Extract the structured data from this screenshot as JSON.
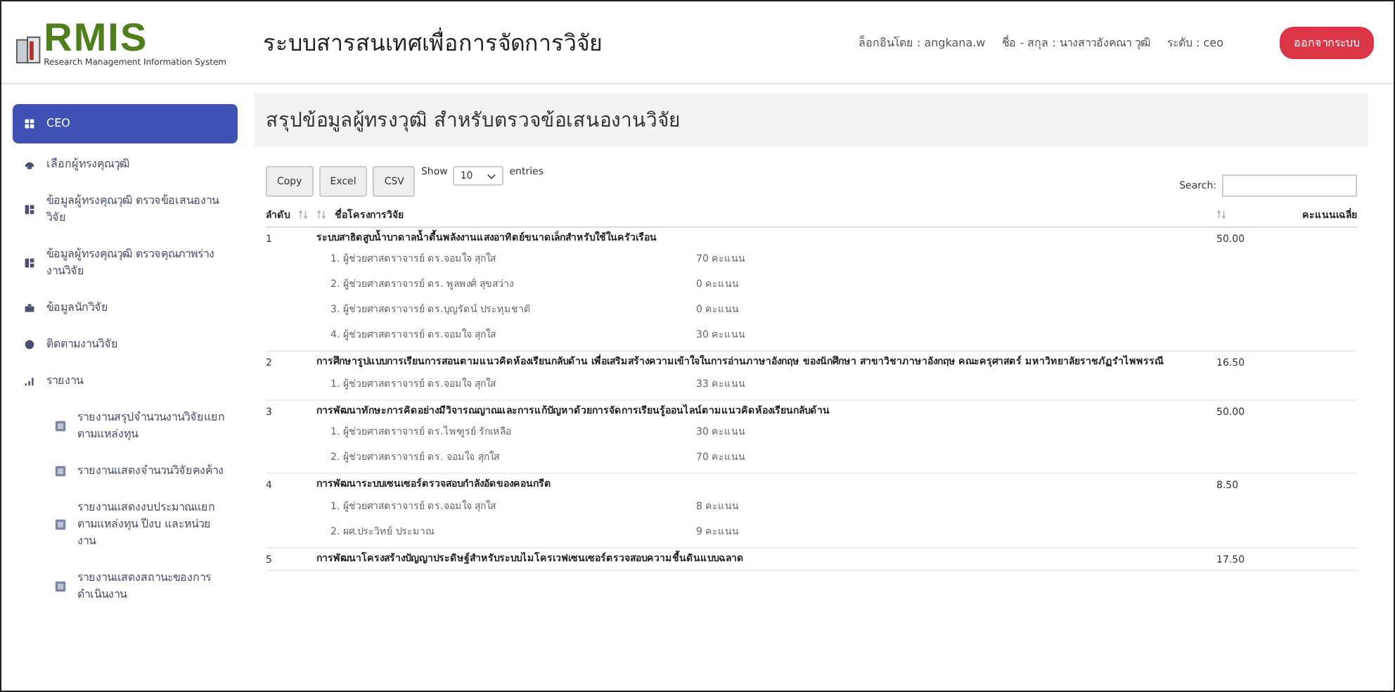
{
  "header": {
    "logo": {
      "letters": "RMIS",
      "tagline": "Research Management Information System"
    },
    "title": "ระบบสารสนเทศเพื่อการจัดการวิจัย",
    "login": "ล็อกอินโดย : angkana.w",
    "name": "ชื่อ - สกุล : นางสาวอังคณา วุฒิ",
    "level": "ระดับ : ceo",
    "logout": "ออกจากระบบ"
  },
  "sidebar": {
    "items": [
      {
        "label": "CEO",
        "selected": true
      },
      {
        "label": "เลือกผู้ทรงคุณวุฒิ",
        "selected": false
      },
      {
        "label": "ข้อมูลผู้ทรงคุณวุฒิ ตรวจข้อเสนองานวิจัย",
        "selected": false
      },
      {
        "label": "ข้อมูลผู้ทรงคุณวุฒิ ตรวจคุณภาพร่างงานวิจัย",
        "selected": false
      },
      {
        "label": "ข้อมูลนักวิจัย",
        "selected": false
      },
      {
        "label": "ติดตามงานวิจัย",
        "selected": false
      },
      {
        "label": "รายงาน",
        "selected": false,
        "children": [
          {
            "label": "รายงานสรุปจำนวนงานวิจัยแยกตามแหล่งทุน",
            "selected": false
          },
          {
            "label": "รายงานแสดงจำนวนวิจัยคงค้าง",
            "selected": false
          },
          {
            "label": "รายงานแสดงงบประมาณแยกตามแหล่งทุน ปีงบ และหน่วยงาน",
            "selected": false
          },
          {
            "label": "รายงานแสดงสถานะของการดำเนินงาน",
            "selected": false
          }
        ]
      }
    ]
  },
  "page_title": "สรุปข้อมูลผู้ทรงวุฒิ สำหรับตรวจข้อเสนองานวิจัย",
  "toolbar": {
    "buttons": [
      "Copy",
      "Excel",
      "CSV"
    ],
    "show_label": "Show",
    "page_size": "10",
    "entries_label": "entries",
    "search_label": "Search:"
  },
  "table": {
    "columns": [
      "ลำดับ",
      "ชื่อโครงการวิจัย",
      "คะแนนเฉลี่ย"
    ],
    "rows": [
      {
        "no": "1",
        "title": "ระบบสาธิตสูบน้ำบาดาลน้ำตื้นพลังงานแสงอาทิตย์ขนาดเล็กสำหรับใช้ในครัวเรือน",
        "average": "50.00",
        "reviewers": [
          {
            "name": "1. ผู้ช่วยศาสตราจารย์ ดร.จอมใจ สุกใส",
            "score": "70 คะแนน"
          },
          {
            "name": "2. ผู้ช่วยศาสตราจารย์ ดร. พูลพงศ์ สุขสว่าง",
            "score": "0 คะแนน"
          },
          {
            "name": "3. ผู้ช่วยศาสตราจารย์ ดร.บุญรัตน์ ประทุมชาติ",
            "score": "0 คะแนน"
          },
          {
            "name": "4. ผู้ช่วยศาสตราจารย์ ดร.จอมใจ สุกใส",
            "score": "30 คะแนน"
          }
        ]
      },
      {
        "no": "2",
        "title": "การศึกษารูปแบบการเรียนการสอนตามแนวคิดห้องเรียนกลับด้าน เพื่อเสริมสร้างความเข้าใจในการอ่านภาษาอังกฤษ ของนักศึกษา สาขาวิชาภาษาอังกฤษ คณะครุศาสตร์ มหาวิทยาลัยราชภัฏรำไพพรรณี",
        "average": "16.50",
        "reviewers": [
          {
            "name": "1. ผู้ช่วยศาสตราจารย์ ดร.จอมใจ สุกใส",
            "score": "33 คะแนน"
          }
        ]
      },
      {
        "no": "3",
        "title": "การพัฒนาทักษะการคิดอย่างมีวิจารณญาณและการแก้ปัญหาด้วยการจัดการเรียนรู้ออนไลน์ตามแนวคิดห้องเรียนกลับด้าน",
        "average": "50.00",
        "reviewers": [
          {
            "name": "1. ผู้ช่วยศาสตราจารย์ ดร.ไพฑูรย์ รักเหลือ",
            "score": "30 คะแนน"
          },
          {
            "name": "2. ผู้ช่วยศาสตราจารย์ ดร. จอมใจ สุกใส",
            "score": "70 คะแนน"
          }
        ]
      },
      {
        "no": "4",
        "title": "การพัฒนาระบบเซนเซอร์ตรวจสอบกำลังอัดของคอนกรีต",
        "average": "8.50",
        "reviewers": [
          {
            "name": "1. ผู้ช่วยศาสตราจารย์ ดร.จอมใจ สุกใส",
            "score": "8 คะแนน"
          },
          {
            "name": "2. ผศ.ประวิทย์ ประมาณ",
            "score": "9 คะแนน"
          }
        ]
      },
      {
        "no": "5",
        "title": "การพัฒนาโครงสร้างปัญญาประดิษฐ์สำหรับระบบไมโครเวฟเซนเซอร์ตรวจสอบความชื้นดินแบบฉลาด",
        "average": "17.50",
        "reviewers": []
      }
    ]
  }
}
